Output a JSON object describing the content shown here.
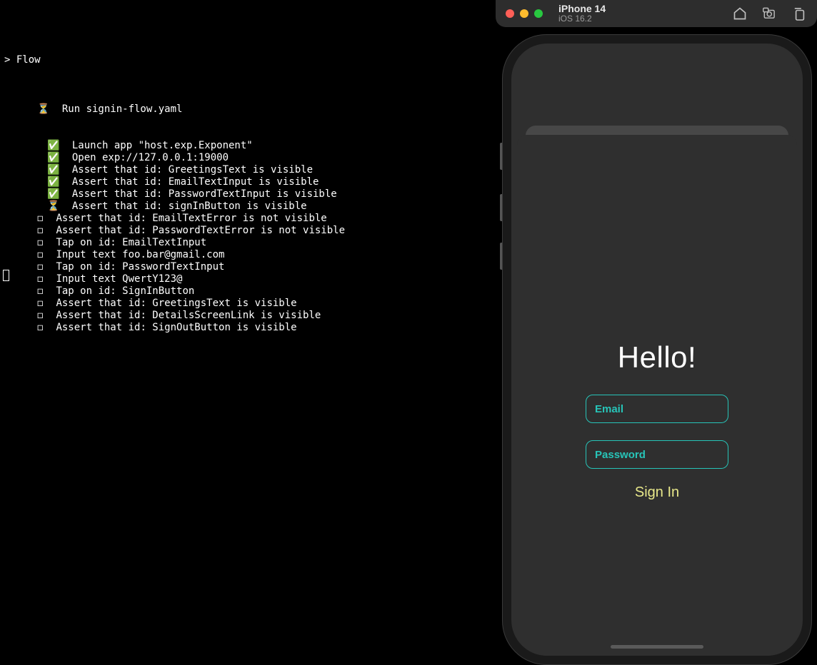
{
  "terminal": {
    "flow_prompt": "> Flow",
    "run_line": {
      "icon": "⏳",
      "text": "Run signin-flow.yaml"
    },
    "steps": [
      {
        "icon": "✅",
        "text": "Launch app \"host.exp.Exponent\"",
        "indent": 2
      },
      {
        "icon": "✅",
        "text": "Open exp://127.0.0.1:19000",
        "indent": 2
      },
      {
        "icon": "✅",
        "text": "Assert that id: GreetingsText is visible",
        "indent": 2
      },
      {
        "icon": "✅",
        "text": "Assert that id: EmailTextInput is visible",
        "indent": 2
      },
      {
        "icon": "✅",
        "text": "Assert that id: PasswordTextInput is visible",
        "indent": 2
      },
      {
        "icon": "⏳",
        "text": "Assert that id: signInButton is visible",
        "indent": 2
      },
      {
        "icon": "◻",
        "text": "Assert that id: EmailTextError is not visible",
        "indent": 0
      },
      {
        "icon": "◻",
        "text": "Assert that id: PasswordTextError is not visible",
        "indent": 0
      },
      {
        "icon": "◻",
        "text": "Tap on id: EmailTextInput",
        "indent": 0
      },
      {
        "icon": "◻",
        "text": "Input text foo.bar@gmail.com",
        "indent": 0
      },
      {
        "icon": "◻",
        "text": "Tap on id: PasswordTextInput",
        "indent": 0
      },
      {
        "icon": "◻",
        "text": "Input text QwertY123@",
        "indent": 0
      },
      {
        "icon": "◻",
        "text": "Tap on id: SignInButton",
        "indent": 0
      },
      {
        "icon": "◻",
        "text": "Assert that id: GreetingsText is visible",
        "indent": 0
      },
      {
        "icon": "◻",
        "text": "Assert that id: DetailsScreenLink is visible",
        "indent": 0
      },
      {
        "icon": "◻",
        "text": "Assert that id: SignOutButton is visible",
        "indent": 0
      }
    ]
  },
  "simulator": {
    "device": "iPhone 14",
    "os": "iOS 16.2"
  },
  "app": {
    "greeting": "Hello!",
    "email_label": "Email",
    "password_label": "Password",
    "signin_label": "Sign In"
  }
}
